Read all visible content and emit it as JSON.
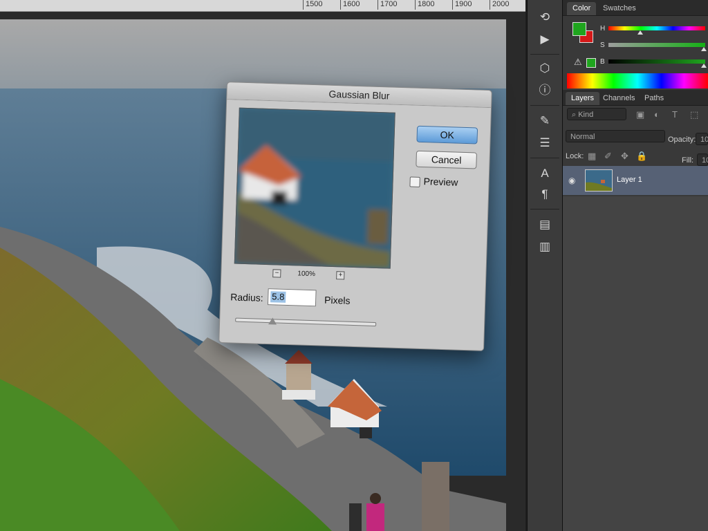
{
  "ruler": {
    "ticks": [
      "1500",
      "1600",
      "1700",
      "1800",
      "1900",
      "2000"
    ]
  },
  "dialog": {
    "title": "Gaussian Blur",
    "ok_label": "OK",
    "cancel_label": "Cancel",
    "preview_label": "Preview",
    "preview_checked": false,
    "zoom_level": "100%",
    "zoom_out": "−",
    "zoom_in": "+",
    "radius_label": "Radius:",
    "radius_value": "5.8",
    "units_label": "Pixels"
  },
  "color_panel": {
    "tabs": [
      "Color",
      "Swatches"
    ],
    "channels": [
      "H",
      "S",
      "B"
    ],
    "foreground_color": "#1fa51e",
    "background_color": "#d41919"
  },
  "layers_panel": {
    "tabs": [
      "Layers",
      "Channels",
      "Paths"
    ],
    "kind_filter": "Kind",
    "blend_mode": "Normal",
    "opacity_label": "Opacity:",
    "opacity_value": "10",
    "lock_label": "Lock:",
    "fill_label": "Fill:",
    "fill_value": "10",
    "layers": [
      {
        "name": "Layer 1",
        "visible": true
      }
    ]
  }
}
